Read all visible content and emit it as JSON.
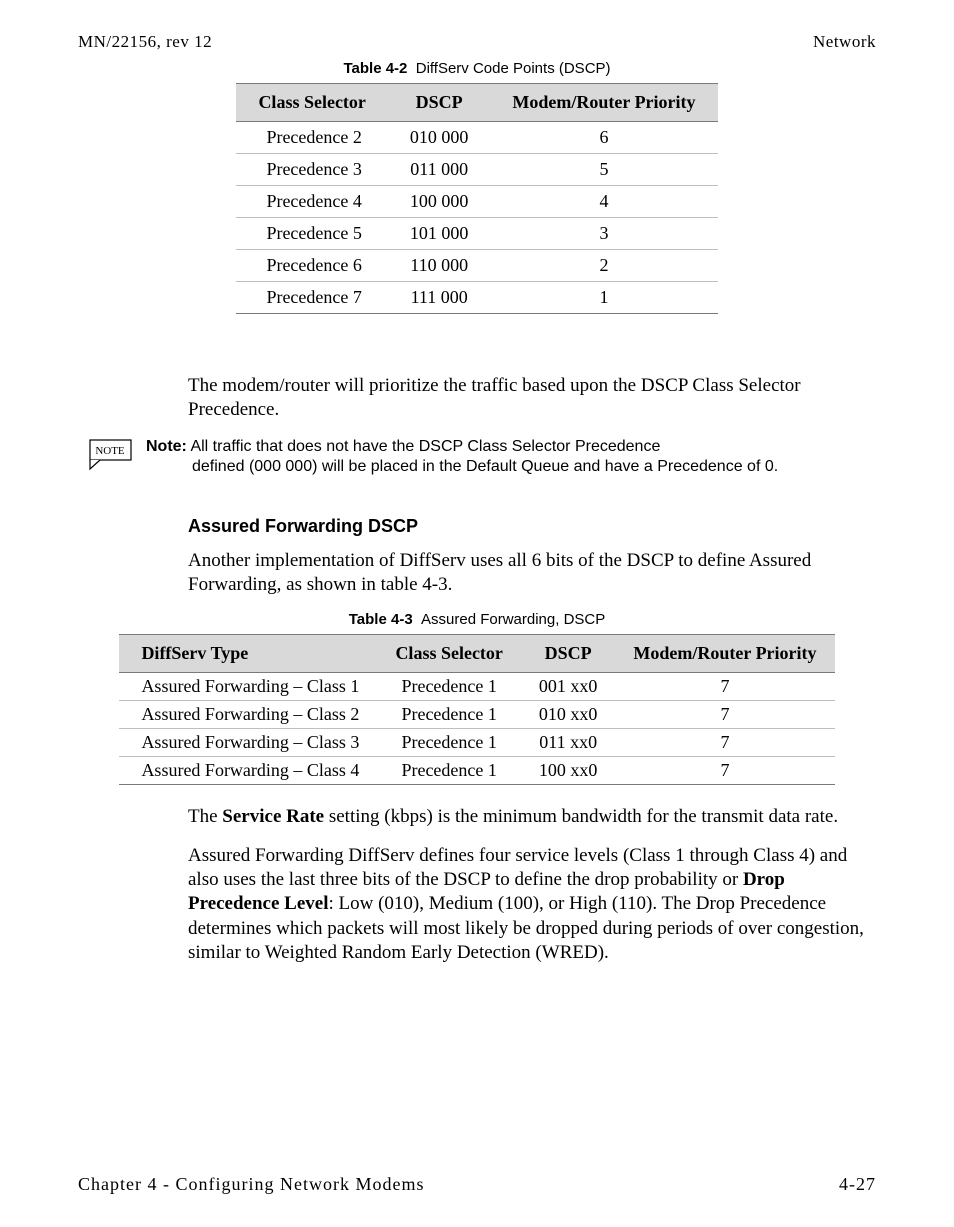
{
  "header": {
    "left": "MN/22156, rev 12",
    "right": "Network"
  },
  "table1": {
    "caption_label": "Table 4-2",
    "caption_text": "DiffServ Code Points (DSCP)",
    "headers": [
      "Class Selector",
      "DSCP",
      "Modem/Router Priority"
    ],
    "rows": [
      [
        "Precedence 2",
        "010 000",
        "6"
      ],
      [
        "Precedence 3",
        "011 000",
        "5"
      ],
      [
        "Precedence 4",
        "100 000",
        "4"
      ],
      [
        "Precedence 5",
        "101 000",
        "3"
      ],
      [
        "Precedence 6",
        "110 000",
        "2"
      ],
      [
        "Precedence 7",
        "111 000",
        "1"
      ]
    ]
  },
  "para1": "The modem/router will prioritize the traffic based upon the DSCP Class Selector Precedence.",
  "note": {
    "icon": "NOTE",
    "label": "Note:",
    "text_line1": "All traffic that does not have the DSCP Class Selector Precedence",
    "text_line2": "defined (000 000) will be placed in the Default Queue and have a Precedence of 0."
  },
  "subheading": "Assured Forwarding DSCP",
  "para2": "Another implementation of DiffServ uses all 6 bits of the DSCP to define Assured Forwarding, as shown in table 4-3.",
  "table2": {
    "caption_label": "Table 4-3",
    "caption_text": "Assured Forwarding, DSCP",
    "headers": [
      "DiffServ Type",
      "Class Selector",
      "DSCP",
      "Modem/Router Priority"
    ],
    "rows": [
      [
        "Assured Forwarding – Class 1",
        "Precedence 1",
        "001 xx0",
        "7"
      ],
      [
        "Assured Forwarding – Class 2",
        "Precedence 1",
        "010 xx0",
        "7"
      ],
      [
        "Assured Forwarding – Class 3",
        "Precedence 1",
        "011 xx0",
        "7"
      ],
      [
        "Assured Forwarding – Class 4",
        "Precedence 1",
        "100 xx0",
        "7"
      ]
    ]
  },
  "para3_pre": "The ",
  "para3_bold": "Service Rate",
  "para3_post": " setting (kbps) is the minimum bandwidth for the transmit data rate.",
  "para4_a": "Assured Forwarding DiffServ defines four service levels (Class 1 through Class 4) and also uses the last three bits of the DSCP to define the drop probability or ",
  "para4_bold": "Drop Precedence Level",
  "para4_b": ": Low (010), Medium (100), or High (110). The Drop Precedence determines which packets will most likely be dropped during periods of over congestion, similar to Weighted Random Early Detection (WRED).",
  "footer": {
    "left": "Chapter 4 - Configuring Network Modems",
    "right": "4-27"
  },
  "chart_data": [
    {
      "type": "table",
      "title": "DiffServ Code Points (DSCP)",
      "columns": [
        "Class Selector",
        "DSCP",
        "Modem/Router Priority"
      ],
      "rows": [
        [
          "Precedence 2",
          "010 000",
          6
        ],
        [
          "Precedence 3",
          "011 000",
          5
        ],
        [
          "Precedence 4",
          "100 000",
          4
        ],
        [
          "Precedence 5",
          "101 000",
          3
        ],
        [
          "Precedence 6",
          "110 000",
          2
        ],
        [
          "Precedence 7",
          "111 000",
          1
        ]
      ]
    },
    {
      "type": "table",
      "title": "Assured Forwarding, DSCP",
      "columns": [
        "DiffServ Type",
        "Class Selector",
        "DSCP",
        "Modem/Router Priority"
      ],
      "rows": [
        [
          "Assured Forwarding – Class 1",
          "Precedence 1",
          "001 xx0",
          7
        ],
        [
          "Assured Forwarding – Class 2",
          "Precedence 1",
          "010 xx0",
          7
        ],
        [
          "Assured Forwarding – Class 3",
          "Precedence 1",
          "011 xx0",
          7
        ],
        [
          "Assured Forwarding – Class 4",
          "Precedence 1",
          "100 xx0",
          7
        ]
      ]
    }
  ]
}
